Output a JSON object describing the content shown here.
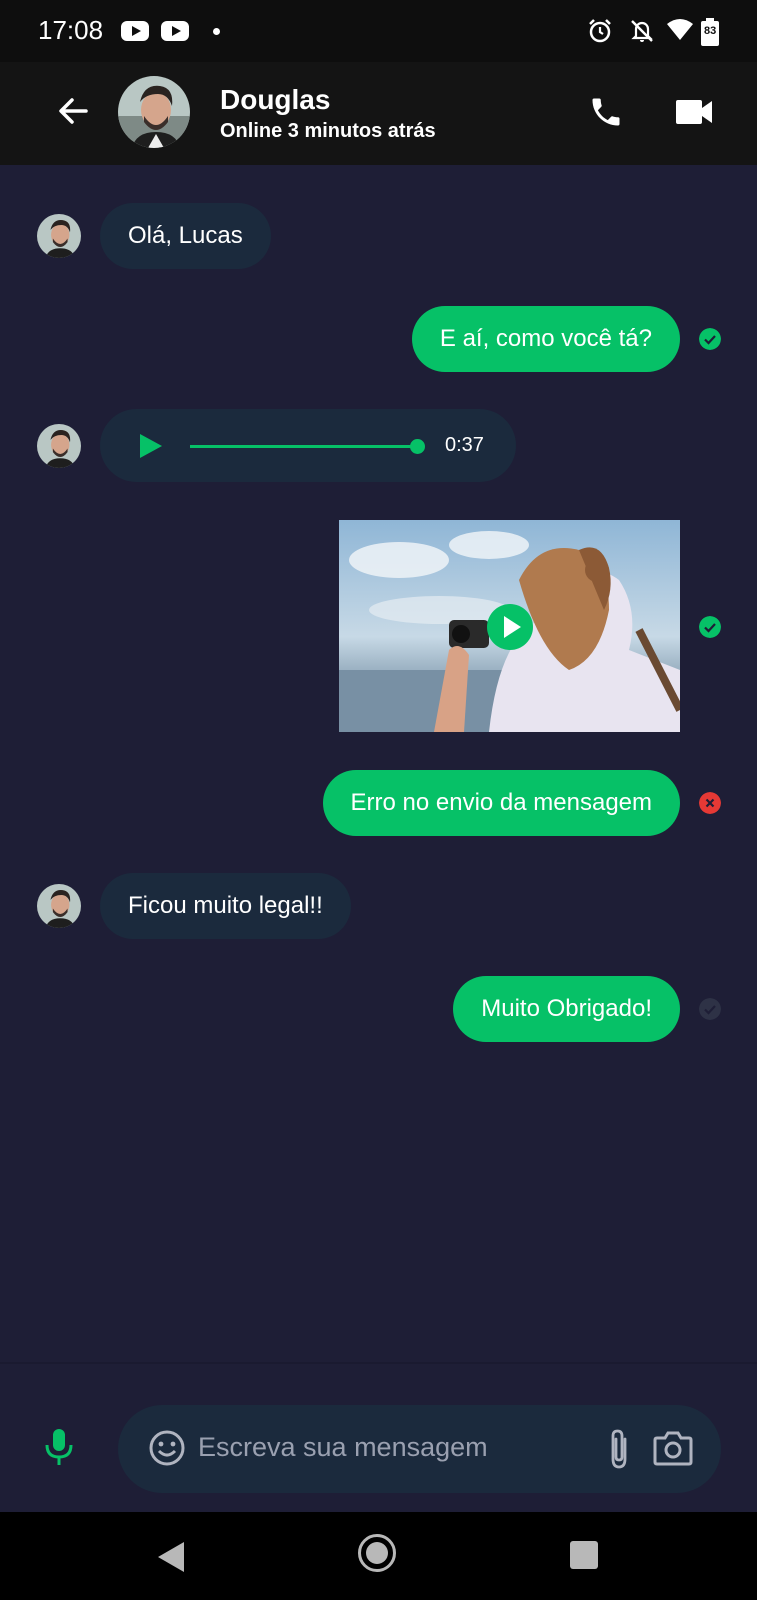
{
  "status_bar": {
    "time": "17:08",
    "battery_level": "83",
    "icons": [
      "youtube-icon",
      "youtube-icon",
      "notification-dot-icon",
      "alarm-icon",
      "notifications-off-icon",
      "wifi-icon",
      "battery-icon"
    ]
  },
  "header": {
    "contact_name": "Douglas",
    "contact_status": "Online 3 minutos atrás",
    "icons": [
      "back-arrow-icon",
      "phone-icon",
      "video-camera-icon"
    ]
  },
  "messages": [
    {
      "direction": "incoming",
      "type": "text",
      "text": "Olá, Lucas"
    },
    {
      "direction": "outgoing",
      "type": "text",
      "text": "E aí, como você tá?",
      "status": "sent"
    },
    {
      "direction": "incoming",
      "type": "audio",
      "duration": "0:37"
    },
    {
      "direction": "outgoing",
      "type": "video",
      "status": "sent"
    },
    {
      "direction": "outgoing",
      "type": "text",
      "text": "Erro no envio da mensagem",
      "status": "error"
    },
    {
      "direction": "incoming",
      "type": "text",
      "text": "Ficou muito legal!!"
    },
    {
      "direction": "outgoing",
      "type": "text",
      "text": "Muito Obrigado!",
      "status": "pending"
    }
  ],
  "composer": {
    "placeholder": "Escreva sua mensagem",
    "icons": [
      "microphone-icon",
      "emoji-icon",
      "attach-icon",
      "camera-icon"
    ]
  },
  "colors": {
    "background": "#1E1E36",
    "header": "#141414",
    "accent": "#06C167",
    "incoming_bubble": "#1B2A3D",
    "error": "#E53935"
  }
}
